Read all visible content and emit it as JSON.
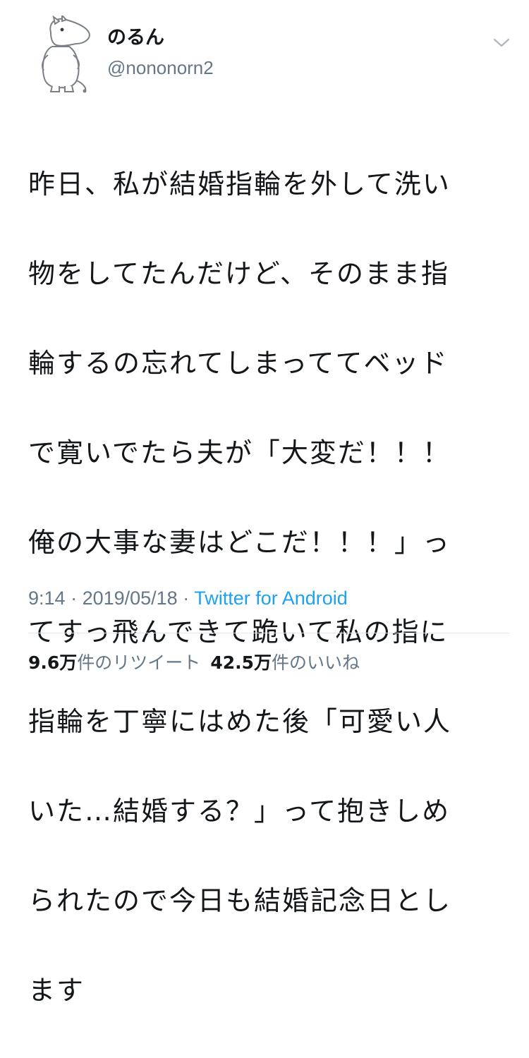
{
  "user": {
    "display_name": "のるん",
    "handle": "@nononorn2",
    "avatar_icon": "moomin-avatar-icon"
  },
  "tweet": {
    "text_lines": [
      "昨日、私が結婚指輪を外して洗い",
      "物をしてたんだけど、そのまま指",
      "輪するの忘れてしまっててベッド",
      "で寛いでたら夫が「大変だ！！！",
      "俺の大事な妻はどこだ！！！」っ",
      "てすっ飛んできて跪いて私の指に",
      "指輪を丁寧にはめた後「可愛い人",
      "いた…結婚する？」って抱きしめ",
      "られたので今日も結婚記念日とし",
      "ます"
    ]
  },
  "meta": {
    "time": "9:14",
    "sep1": " · ",
    "date": "2019/05/18",
    "sep2": " · ",
    "source": "Twitter for Android"
  },
  "stats": {
    "retweets_count": "9.6万",
    "retweets_label": "件のリツイート",
    "likes_count": "42.5万",
    "likes_label": "件のいいね"
  },
  "colors": {
    "text": "#14171a",
    "secondary": "#657786",
    "link": "#1da1f2",
    "divider": "#e1e8ed"
  }
}
